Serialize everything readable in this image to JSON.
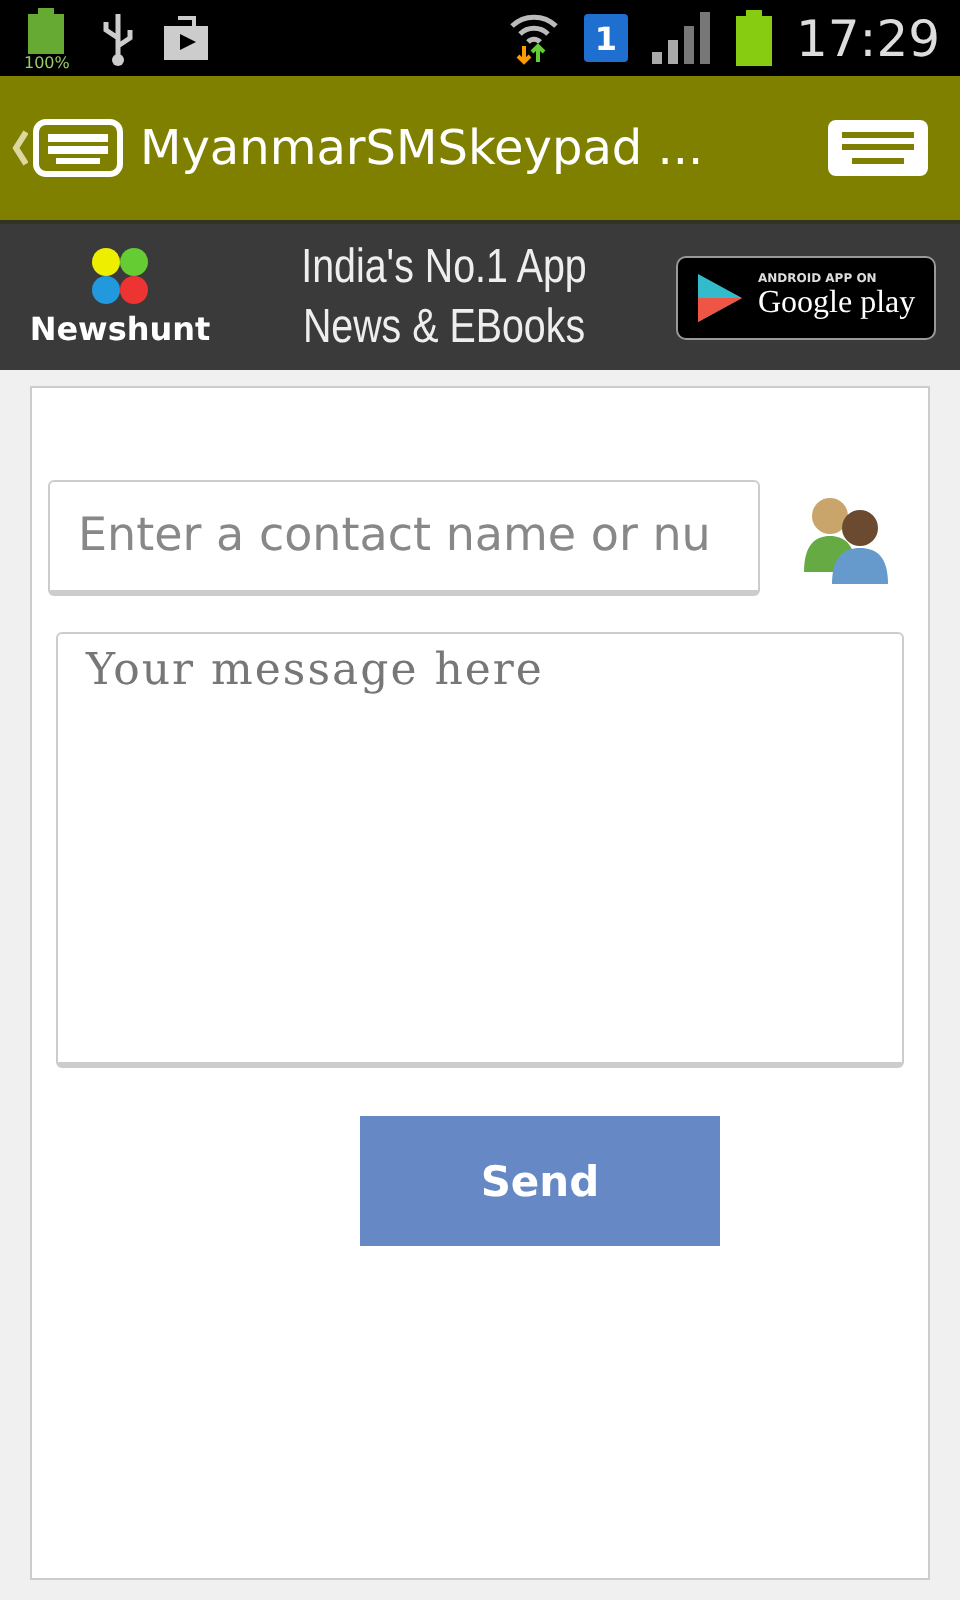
{
  "status_bar": {
    "battery_percent": "100%",
    "sim_badge": "1",
    "time": "17:29"
  },
  "action_bar": {
    "title": "MyanmarSMSkeypad ..."
  },
  "ad_banner": {
    "brand": "Newshunt",
    "headline": [
      "India's No.1 App",
      "News & EBooks"
    ],
    "store_caption": "ANDROID APP ON",
    "store_name": "Google play"
  },
  "form": {
    "contact_placeholder": "Enter a contact name or nu",
    "message_placeholder": "Your message here",
    "send_label": "Send"
  }
}
